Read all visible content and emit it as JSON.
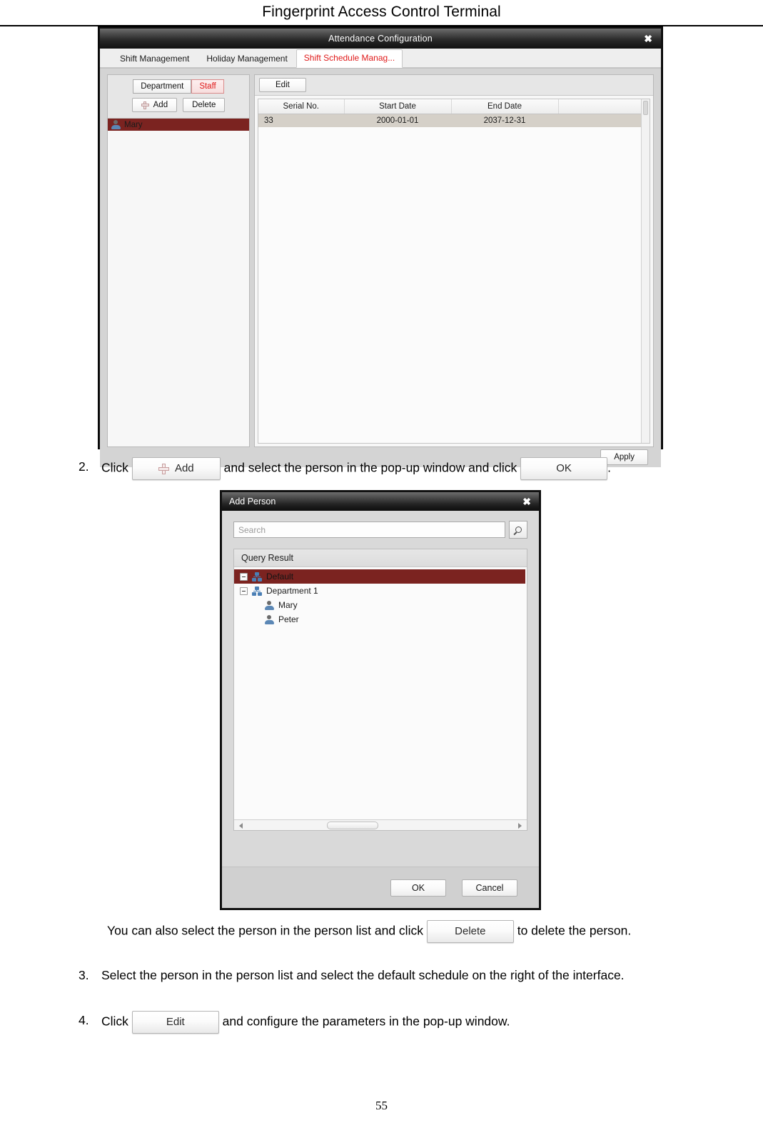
{
  "page": {
    "header_title": "Fingerprint Access Control Terminal",
    "page_number": "55"
  },
  "attendance_window": {
    "title": "Attendance Configuration",
    "close_icon": "close-icon",
    "tabs": [
      {
        "label": "Shift Management",
        "active": false
      },
      {
        "label": "Holiday Management",
        "active": false
      },
      {
        "label": "Shift Schedule Manag...",
        "active": true
      }
    ],
    "left_pane": {
      "toggles": [
        {
          "label": "Department",
          "selected": false
        },
        {
          "label": "Staff",
          "selected": true
        }
      ],
      "buttons": [
        {
          "label": "Add",
          "icon": "plus-icon"
        },
        {
          "label": "Delete",
          "icon": ""
        }
      ],
      "persons": [
        {
          "name": "Mary",
          "selected": true,
          "icon": "user-icon"
        }
      ]
    },
    "right_pane": {
      "edit_button": "Edit",
      "columns": [
        "Serial No.",
        "Start Date",
        "End Date",
        ""
      ],
      "rows": [
        {
          "serial_no": "33",
          "start_date": "2000-01-01",
          "end_date": "2037-12-31",
          "extra": ""
        }
      ]
    },
    "apply_button": "Apply"
  },
  "steps": {
    "step2": {
      "number": "2.",
      "text_before": "Click",
      "btn_add": "Add",
      "btn_add_icon": "plus-icon",
      "text_middle": "and select the person in the pop-up window and click",
      "btn_ok": "OK",
      "text_after": "."
    },
    "note": {
      "text_before": "You can also select the person in the person list and click",
      "btn_delete": "Delete",
      "text_after": "to delete the person."
    },
    "step3": {
      "number": "3.",
      "text": "Select the person in the person list and select the default schedule on the right of the interface."
    },
    "step4": {
      "number": "4.",
      "text_before": "Click",
      "btn_edit": "Edit",
      "text_after": "and configure the parameters in the pop-up window."
    }
  },
  "add_person_window": {
    "title": "Add Person",
    "close_icon": "close-icon",
    "search_placeholder": "Search",
    "search_value": "",
    "search_icon": "magnifier-icon",
    "query_result_label": "Query Result",
    "tree": [
      {
        "label": "Default",
        "level": 0,
        "selected": true,
        "icon": "department-icon",
        "expander": "minus-icon"
      },
      {
        "label": "Department 1",
        "level": 0,
        "selected": false,
        "icon": "department-icon",
        "expander": "minus-icon"
      },
      {
        "label": "Mary",
        "level": 1,
        "selected": false,
        "icon": "user-icon",
        "expander": ""
      },
      {
        "label": "Peter",
        "level": 1,
        "selected": false,
        "icon": "user-icon",
        "expander": ""
      }
    ],
    "ok_button": "OK",
    "cancel_button": "Cancel"
  },
  "colors": {
    "accent_red": "#e01b1b",
    "selection_dark_red": "#7b2320",
    "titlebar_dark": "#1a1a1a",
    "row_highlight": "#d5d0c8"
  }
}
